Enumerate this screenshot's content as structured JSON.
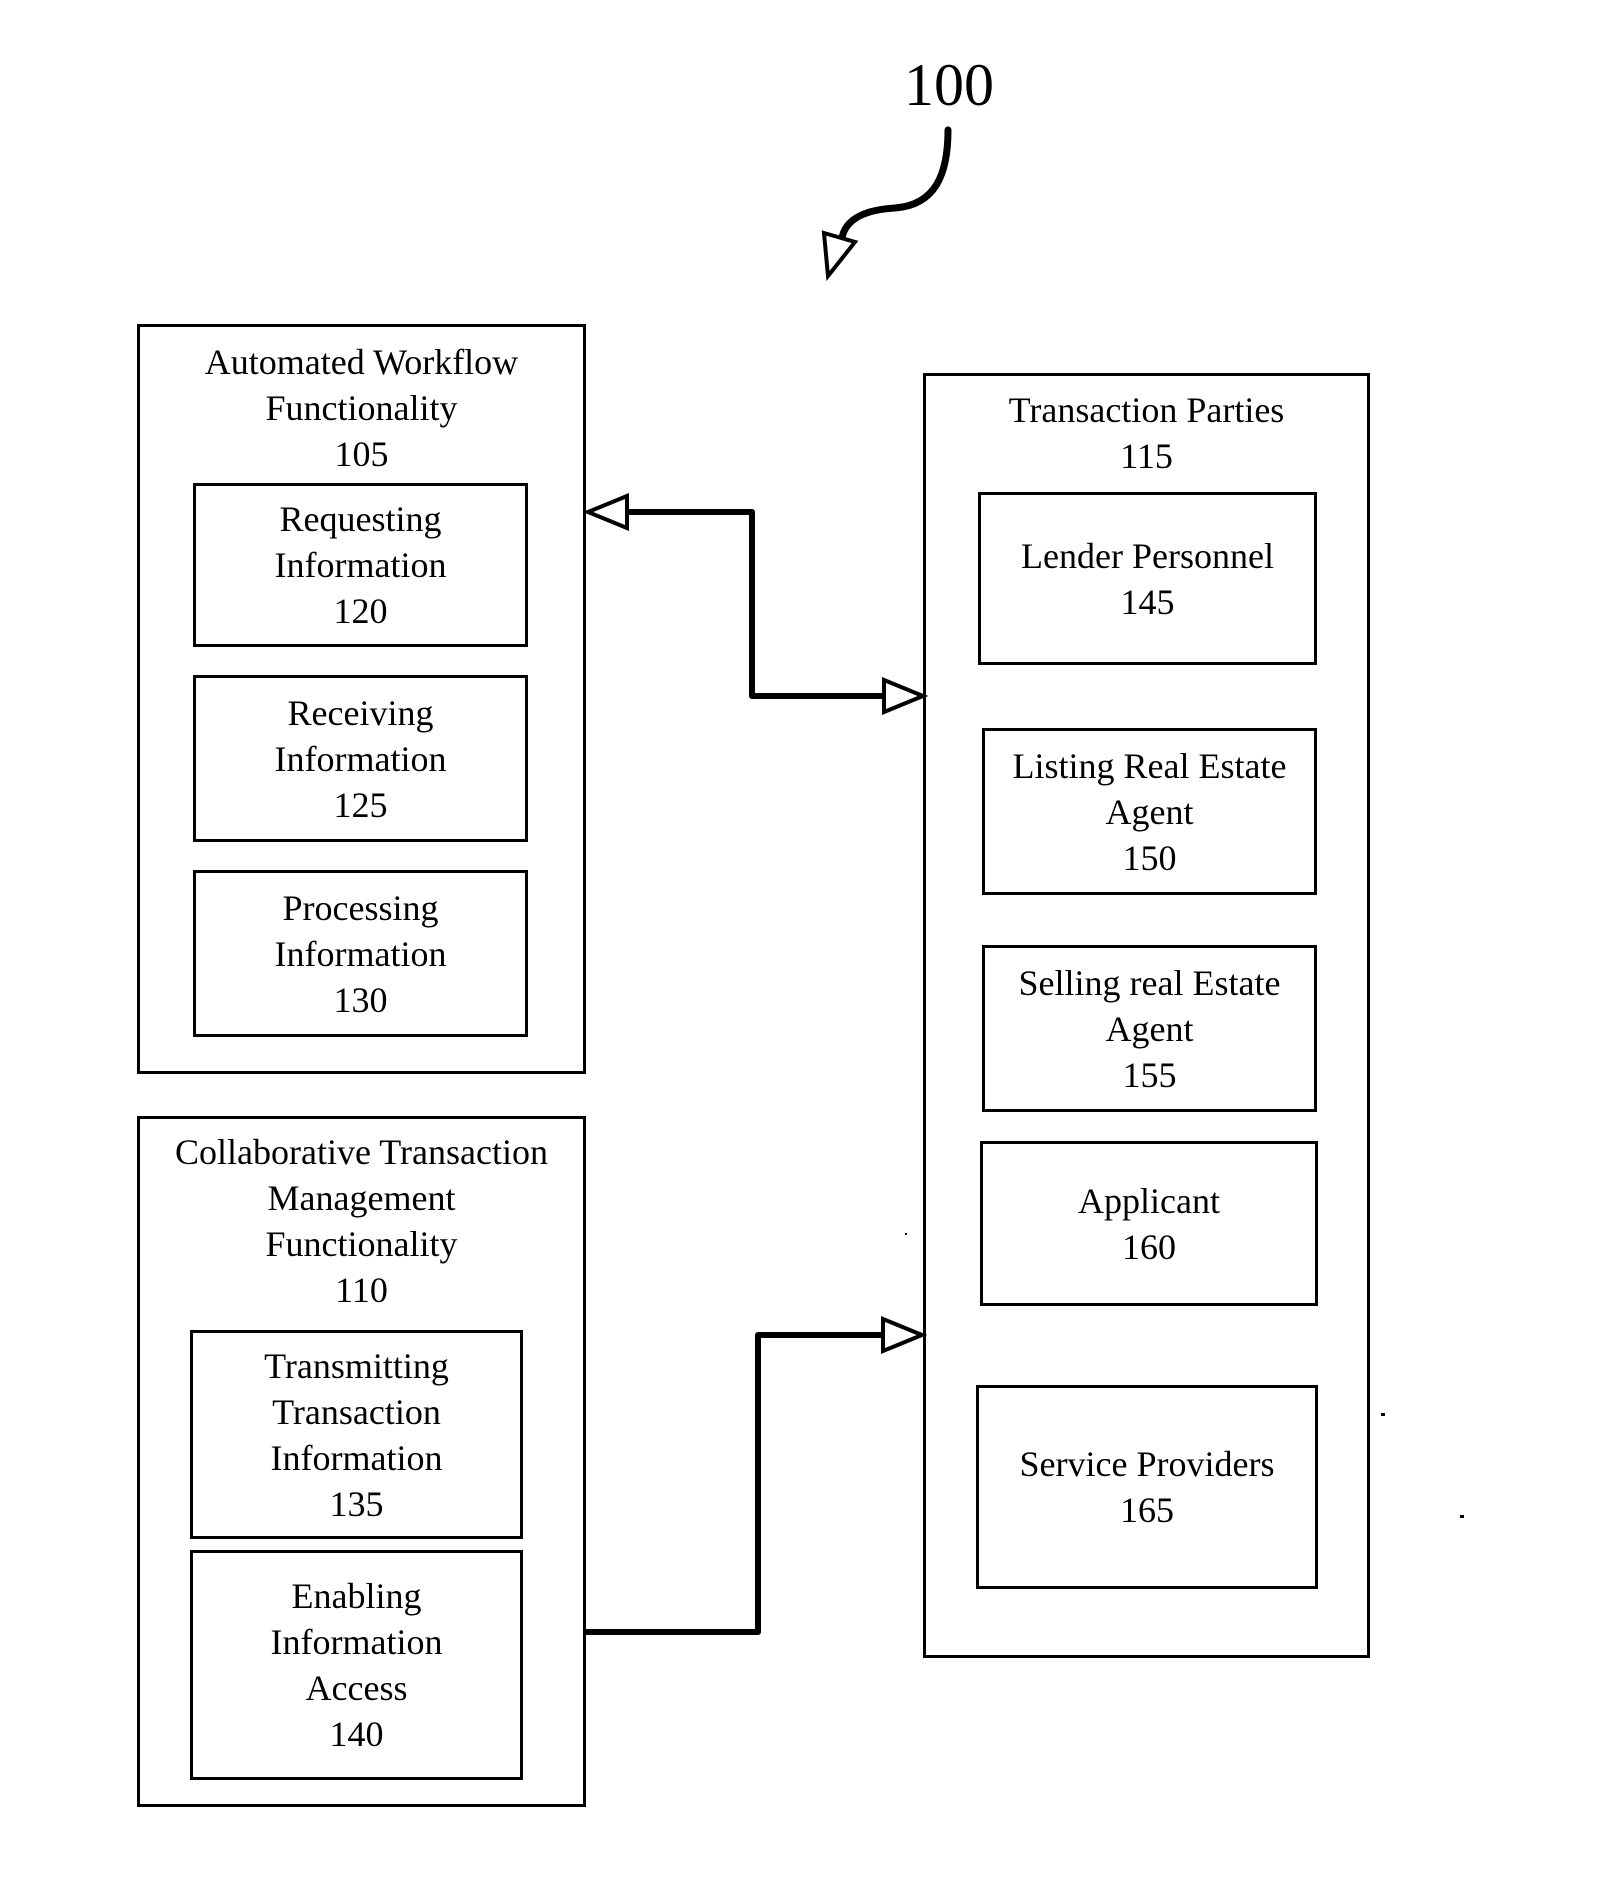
{
  "figure": {
    "reference": "100"
  },
  "groups": [
    {
      "id": "105",
      "title": "Automated Workflow\nFunctionality\n105",
      "items": [
        {
          "id": "120",
          "label": "Requesting\nInformation\n120"
        },
        {
          "id": "125",
          "label": "Receiving\nInformation\n125"
        },
        {
          "id": "130",
          "label": "Processing\nInformation\n130"
        }
      ]
    },
    {
      "id": "110",
      "title": "Collaborative Transaction\nManagement\nFunctionality\n110",
      "items": [
        {
          "id": "135",
          "label": "Transmitting\nTransaction\nInformation\n135"
        },
        {
          "id": "140",
          "label": "Enabling\nInformation\nAccess\n140"
        }
      ]
    },
    {
      "id": "115",
      "title": "Transaction Parties\n115",
      "items": [
        {
          "id": "145",
          "label": "Lender Personnel\n145"
        },
        {
          "id": "150",
          "label": "Listing Real Estate\nAgent\n150"
        },
        {
          "id": "155",
          "label": "Selling real Estate\nAgent\n155"
        },
        {
          "id": "160",
          "label": "Applicant\n160"
        },
        {
          "id": "165",
          "label": "Service Providers\n165"
        }
      ]
    }
  ],
  "connectors": [
    {
      "from": "105",
      "to": "115",
      "direction": "bidirectional"
    },
    {
      "from": "140",
      "to": "115",
      "direction": "one-way"
    }
  ]
}
